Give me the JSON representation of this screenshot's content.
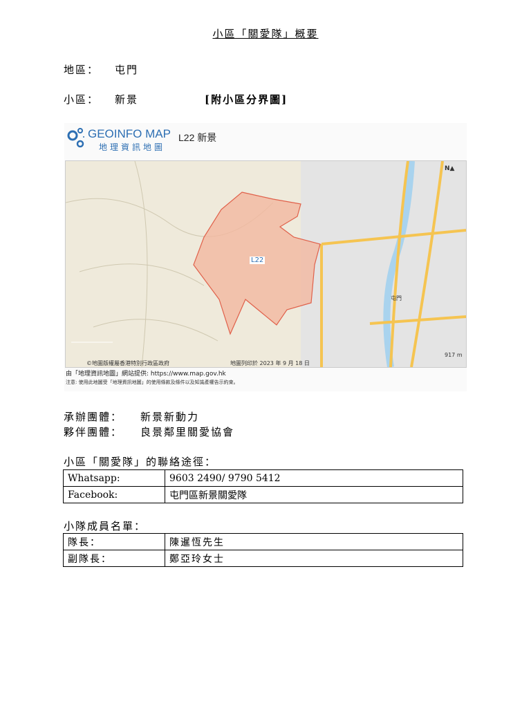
{
  "title": "小區「關愛隊」概要",
  "district_label": "地區：",
  "district": "屯門",
  "subdistrict_label": "小區：",
  "subdistrict": "新景",
  "map_link": "[附小區分界圖]",
  "map": {
    "logo_en": "GEOINFO MAP",
    "logo_zh": "地理資訊地圖",
    "code_title": "L22 新景",
    "area_label": "L22",
    "place_tuenmun": "屯門",
    "scale": "917 m",
    "copyright": "©地圖版權屬香港特別行政區政府",
    "print_date": "地圖列印於 2023 年 9 月 18 日",
    "credit": "由「地理資訊地圖」網站提供: https://www.map.gov.hk",
    "note": "注意: 使用此地圖受「地理資訊地圖」的使用條款及條件以及知識產權告示約束。",
    "colors": {
      "area_fill": "#f3b8a0",
      "area_stroke": "#e0604a",
      "road": "#f5c451",
      "river": "#a9d3ee"
    }
  },
  "organizer_label": "承辦團體：",
  "organizer": "新景新動力",
  "partner_label": "夥伴團體：",
  "partner": "良景鄰里關愛協會",
  "contact_heading": "小區「關愛隊」的聯絡途徑：",
  "contacts": [
    {
      "k": "Whatsapp:",
      "v": "9603 2490/ 9790 5412"
    },
    {
      "k": "Facebook:",
      "v": "屯門區新景關愛隊"
    }
  ],
  "members_heading": "小隊成員名單：",
  "members": [
    {
      "k": "隊長：",
      "v": "陳暹恆先生"
    },
    {
      "k": "副隊長：",
      "v": "鄭亞玲女士"
    }
  ]
}
